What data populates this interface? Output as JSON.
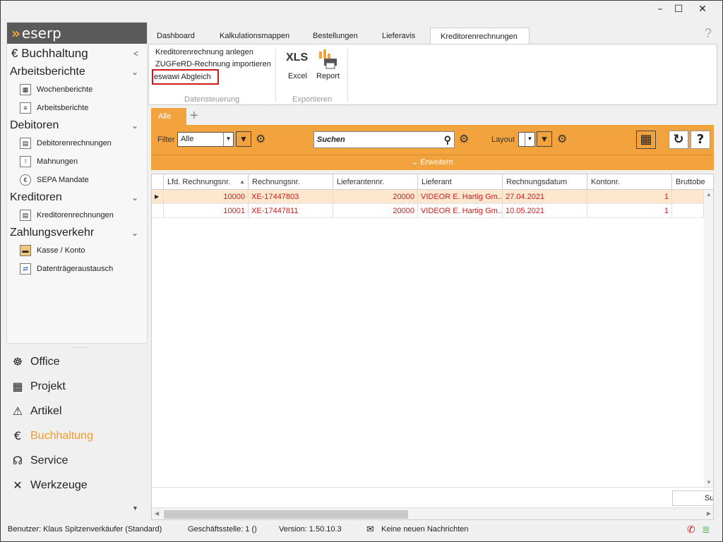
{
  "window": {
    "min_glyph": "–",
    "max_glyph": "☐",
    "close_glyph": "✕"
  },
  "app": {
    "logo": "eserp"
  },
  "sidebar": {
    "header": "Buchhaltung",
    "categories": [
      {
        "label": "Arbeitsberichte",
        "items": [
          {
            "label": "Wochenberichte",
            "icon": "calendar-icon"
          },
          {
            "label": "Arbeitsberichte",
            "icon": "report-icon"
          }
        ]
      },
      {
        "label": "Debitoren",
        "items": [
          {
            "label": "Debitorenrechnungen",
            "icon": "invoice-icon"
          },
          {
            "label": "Mahnungen",
            "icon": "reminder-icon"
          },
          {
            "label": "SEPA Mandate",
            "icon": "sepa-icon"
          }
        ]
      },
      {
        "label": "Kreditoren",
        "items": [
          {
            "label": "Kreditorenrechnungen",
            "icon": "invoice-icon"
          }
        ]
      },
      {
        "label": "Zahlungsverkehr",
        "items": [
          {
            "label": "Kasse / Konto",
            "icon": "cash-icon"
          },
          {
            "label": "Datenträgeraustausch",
            "icon": "exchange-icon"
          }
        ]
      }
    ],
    "modules": [
      {
        "label": "Office",
        "icon": "wheel-icon"
      },
      {
        "label": "Projekt",
        "icon": "project-icon"
      },
      {
        "label": "Artikel",
        "icon": "siren-icon"
      },
      {
        "label": "Buchhaltung",
        "icon": "euro-icon",
        "active": true
      },
      {
        "label": "Service",
        "icon": "headset-icon"
      },
      {
        "label": "Werkzeuge",
        "icon": "tools-icon"
      }
    ]
  },
  "tabs": [
    "Dashboard",
    "Kalkulationsmappen",
    "Bestellungen",
    "Lieferavis",
    "Kreditorenrechnungen"
  ],
  "ribbon": {
    "links": [
      "Kreditorenrechnung anlegen",
      "ZUGFeRD-Rechnung importieren",
      "eswawi Abgleich"
    ],
    "group1": "Datensteuerung",
    "xls": "XLS",
    "excel": "Excel",
    "report": "Report",
    "group2": "Exportieren"
  },
  "filter_tab": "Alle",
  "toolbar": {
    "filter_label": "Filter",
    "filter_value": "Alle",
    "search_placeholder": "Suchen",
    "layout_label": "Layout",
    "layout_value": "",
    "expand": "Erweitern"
  },
  "table": {
    "columns": [
      "Lfd. Rechnungsnr.",
      "Rechnungsnr.",
      "Lieferantennr.",
      "Lieferant",
      "Rechnungsdatum",
      "Kontonr.",
      "Bruttobe"
    ],
    "rows": [
      [
        "10000",
        "XE-17447803",
        "20000",
        "VIDEOR E. Hartig Gm...",
        "27.04.2021",
        "1",
        ""
      ],
      [
        "10001",
        "XE-17447811",
        "20000",
        "VIDEOR E. Hartig Gm...",
        "10.05.2021",
        "1",
        ""
      ]
    ],
    "sum_label": "Su"
  },
  "status": {
    "user": "Benutzer: Klaus Spitzenverkäufer (Standard)",
    "branch": "Geschäftsstelle: 1 ()",
    "version": "Version: 1.50.10.3",
    "messages": "Keine neuen Nachrichten"
  },
  "colors": {
    "accent": "#f2a33d",
    "active_module": "#f29a2e",
    "row_text": "#d01a1a",
    "highlight_border": "#d01a1a"
  }
}
